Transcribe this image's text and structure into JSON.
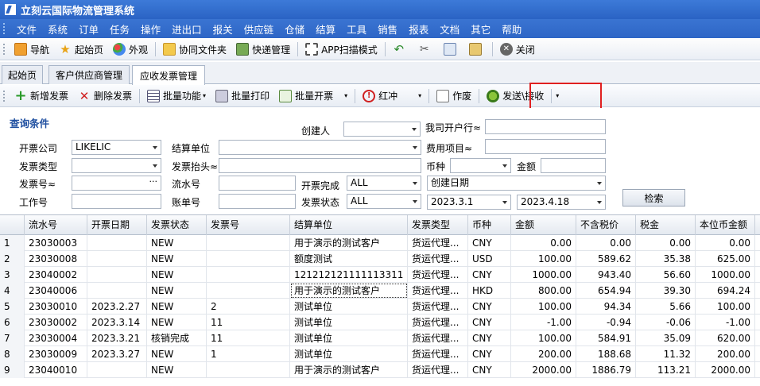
{
  "app": {
    "title": "立刻云国际物流管理系统"
  },
  "menu": [
    "文件",
    "系统",
    "订单",
    "任务",
    "操作",
    "进出口",
    "报关",
    "供应链",
    "仓储",
    "结算",
    "工具",
    "销售",
    "报表",
    "文档",
    "其它",
    "帮助"
  ],
  "toolbar": {
    "nav": "导航",
    "home": "起始页",
    "appearance": "外观",
    "shared_folder": "协同文件夹",
    "express": "快递管理",
    "app_scan": "APP扫描模式",
    "close": "关闭"
  },
  "tabs": [
    "起始页",
    "客户供应商管理",
    "应收发票管理"
  ],
  "toolbar2": {
    "add": "新增发票",
    "delete": "删除发票",
    "batch_func": "批量功能",
    "batch_print": "批量打印",
    "batch_issue": "批量开票",
    "red": "红冲",
    "void": "作废",
    "send_recv": "发送\\接收"
  },
  "query": {
    "title": "查询条件",
    "labels": {
      "creator": "创建人",
      "our_bank": "我司开户行≈",
      "company": "开票公司",
      "settle_unit": "结算单位",
      "fee_item": "费用项目≈",
      "invoice_type": "发票类型",
      "invoice_header": "发票抬头≈",
      "currency": "币种",
      "amount": "金额",
      "invoice_no": "发票号≈",
      "serial_no": "流水号",
      "issue_done": "开票完成",
      "work_no": "工作号",
      "account_no": "账单号",
      "invoice_status": "发票状态"
    },
    "values": {
      "company": "LIKELIC",
      "issue_done": "ALL",
      "invoice_status": "ALL",
      "date_field": "创建日期",
      "date_from": "2023.3.1",
      "date_to": "2023.4.18"
    },
    "search_button": "检索"
  },
  "grid": {
    "columns": [
      "流水号",
      "开票日期",
      "发票状态",
      "发票号",
      "结算单位",
      "发票类型",
      "币种",
      "金额",
      "不含税价",
      "税金",
      "本位币金额"
    ],
    "rows": [
      {
        "n": "1",
        "serial": "23030003",
        "date": "",
        "status": "NEW",
        "inv": "",
        "unit": "用于演示的测试客户",
        "type": "货运代理...",
        "cur": "CNY",
        "amount": "0.00",
        "notax": "0.00",
        "tax": "0.00",
        "base": "0.00"
      },
      {
        "n": "2",
        "serial": "23030008",
        "date": "",
        "status": "NEW",
        "inv": "",
        "unit": "额度测试",
        "type": "货运代理...",
        "cur": "USD",
        "amount": "100.00",
        "notax": "589.62",
        "tax": "35.38",
        "base": "625.00"
      },
      {
        "n": "3",
        "serial": "23040002",
        "date": "",
        "status": "NEW",
        "inv": "",
        "unit": "121212121111113311",
        "type": "货运代理...",
        "cur": "CNY",
        "amount": "1000.00",
        "notax": "943.40",
        "tax": "56.60",
        "base": "1000.00"
      },
      {
        "n": "4",
        "serial": "23040006",
        "date": "",
        "status": "NEW",
        "inv": "",
        "unit": "用于演示的测试客户",
        "type": "货运代理...",
        "cur": "HKD",
        "amount": "800.00",
        "notax": "654.94",
        "tax": "39.30",
        "base": "694.24"
      },
      {
        "n": "5",
        "serial": "23030010",
        "date": "2023.2.27",
        "status": "NEW",
        "inv": "2",
        "unit": "测试单位",
        "type": "货运代理...",
        "cur": "CNY",
        "amount": "100.00",
        "notax": "94.34",
        "tax": "5.66",
        "base": "100.00"
      },
      {
        "n": "6",
        "serial": "23030002",
        "date": "2023.3.14",
        "status": "NEW",
        "inv": "11",
        "unit": "测试单位",
        "type": "货运代理...",
        "cur": "CNY",
        "amount": "-1.00",
        "notax": "-0.94",
        "tax": "-0.06",
        "base": "-1.00"
      },
      {
        "n": "7",
        "serial": "23030004",
        "date": "2023.3.21",
        "status": "核销完成",
        "inv": "11",
        "unit": "测试单位",
        "type": "货运代理...",
        "cur": "CNY",
        "amount": "100.00",
        "notax": "584.91",
        "tax": "35.09",
        "base": "620.00"
      },
      {
        "n": "8",
        "serial": "23030009",
        "date": "2023.3.27",
        "status": "NEW",
        "inv": "1",
        "unit": "测试单位",
        "type": "货运代理...",
        "cur": "CNY",
        "amount": "200.00",
        "notax": "188.68",
        "tax": "11.32",
        "base": "200.00"
      },
      {
        "n": "9",
        "serial": "23040010",
        "date": "",
        "status": "NEW",
        "inv": "",
        "unit": "用于演示的测试客户",
        "type": "货运代理...",
        "cur": "CNY",
        "amount": "2000.00",
        "notax": "1886.79",
        "tax": "113.21",
        "base": "2000.00"
      }
    ]
  }
}
